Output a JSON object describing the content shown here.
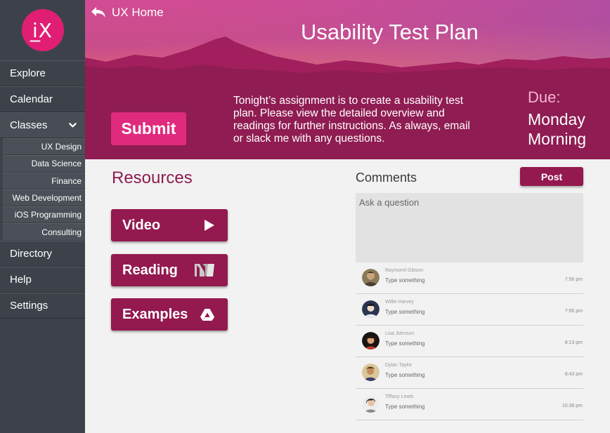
{
  "logo": {
    "text": "i̲X"
  },
  "sidebar": {
    "items": [
      {
        "label": "Explore"
      },
      {
        "label": "Calendar"
      },
      {
        "label": "Classes"
      },
      {
        "label": "Directory"
      },
      {
        "label": "Help"
      },
      {
        "label": "Settings"
      }
    ],
    "classes": [
      {
        "label": "UX Design"
      },
      {
        "label": "Data Science"
      },
      {
        "label": "Finance"
      },
      {
        "label": "Web Development"
      },
      {
        "label": "iOS Programming"
      },
      {
        "label": "Consulting"
      }
    ]
  },
  "header": {
    "back_label": "UX Home",
    "title": "Usability Test Plan",
    "submit_label": "Submit",
    "assignment": "Tonight’s assignment is to create a usability test plan.  Please view the detailed overview and readings for further instructions. As always, email or slack me with any questions.",
    "due_label": "Due:",
    "due_line1": "Monday",
    "due_line2": "Morning"
  },
  "resources": {
    "title": "Resources",
    "buttons": [
      {
        "label": "Video",
        "icon": "play-icon"
      },
      {
        "label": "Reading",
        "icon": "medium-icon"
      },
      {
        "label": "Examples",
        "icon": "google-drive-icon"
      }
    ]
  },
  "comments": {
    "title": "Comments",
    "post_label": "Post",
    "placeholder": "Ask a question",
    "items": [
      {
        "name": "Raymond Gibson",
        "text": "Type something",
        "time": "7:56 pm"
      },
      {
        "name": "Willie Harvey",
        "text": "Type something",
        "time": "7:56 pm"
      },
      {
        "name": "Lisa Johnson",
        "text": "Type something",
        "time": "8:13 pm"
      },
      {
        "name": "Dylan Taylor",
        "text": "Type something",
        "time": "8:43 pm"
      },
      {
        "name": "Tiffany Lewis",
        "text": "Type something",
        "time": "10:38 pm"
      }
    ]
  },
  "colors": {
    "brand_pink": "#e01f74",
    "header_maroon": "#8f1c52",
    "button_maroon": "#93194f",
    "sidebar": "#3d424a"
  }
}
